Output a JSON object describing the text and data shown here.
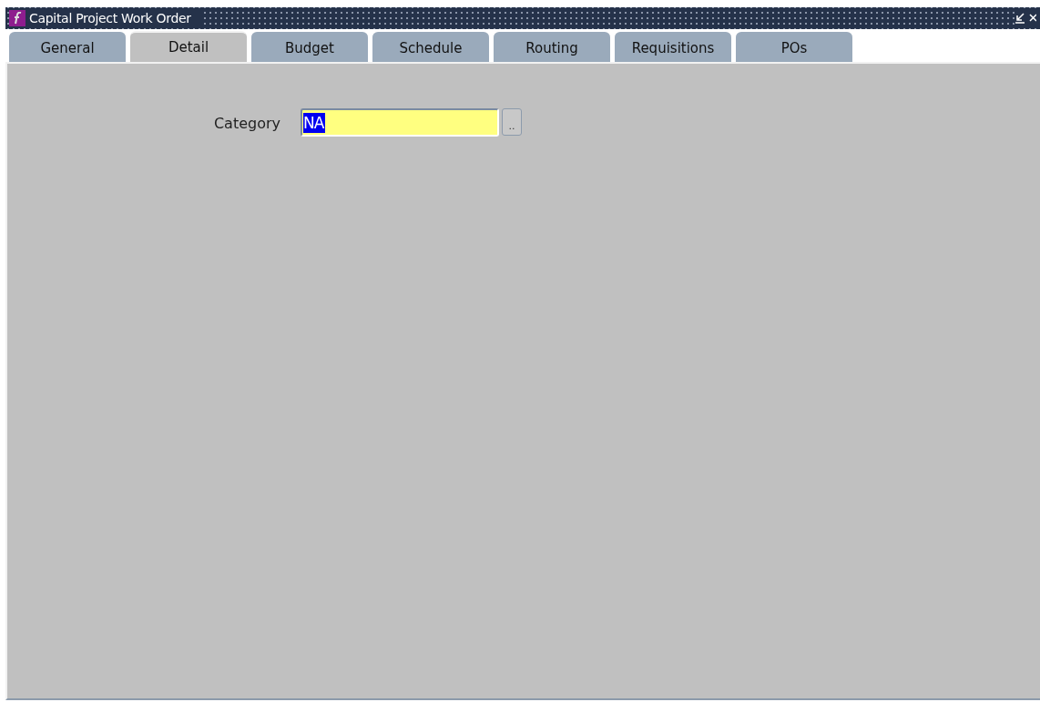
{
  "window": {
    "title": "Capital Project Work Order"
  },
  "tabs": [
    {
      "label": "General",
      "selected": false
    },
    {
      "label": "Detail",
      "selected": true
    },
    {
      "label": "Budget",
      "selected": false
    },
    {
      "label": "Schedule",
      "selected": false
    },
    {
      "label": "Routing",
      "selected": false
    },
    {
      "label": "Requisitions",
      "selected": false
    },
    {
      "label": "POs",
      "selected": false
    }
  ],
  "category": {
    "label": "Category",
    "value": "NA",
    "value_highlighted": true,
    "lov_button": ".."
  }
}
